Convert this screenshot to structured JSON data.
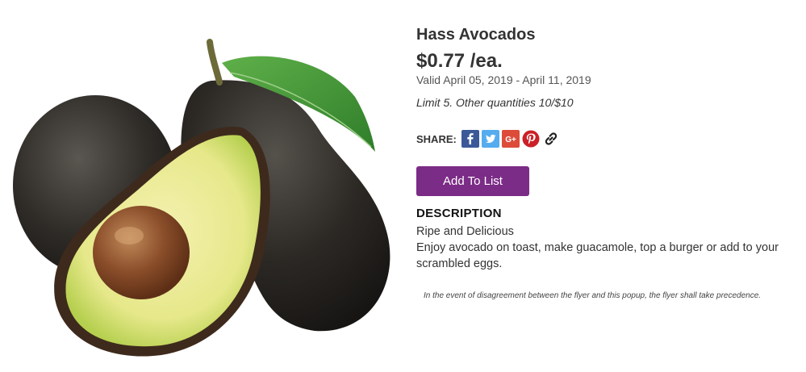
{
  "product": {
    "image_alt": "Hass avocados, one whole and one halved with pit",
    "title": "Hass Avocados",
    "price": "$0.77 /ea.",
    "valid": "Valid April 05, 2019 - April 11, 2019",
    "limit": "Limit 5. Other quantities 10/$10"
  },
  "share": {
    "label": "SHARE:",
    "buttons": [
      {
        "icon": "facebook-icon",
        "glyph": "f",
        "color": "#3b5998"
      },
      {
        "icon": "twitter-icon",
        "glyph": "t",
        "color": "#55acee"
      },
      {
        "icon": "google-plus-icon",
        "glyph": "G+",
        "color": "#dd4b39"
      },
      {
        "icon": "pinterest-icon",
        "glyph": "P",
        "color": "#cb2027"
      },
      {
        "icon": "link-icon",
        "glyph": "🔗",
        "color": "#333333"
      }
    ]
  },
  "actions": {
    "add_to_list": "Add To List",
    "button_color": "#7b2c86"
  },
  "description": {
    "heading": "DESCRIPTION",
    "line1": "Ripe and Delicious",
    "line2": "Enjoy avocado on toast, make guacamole, top a burger or add to your scrambled eggs."
  },
  "disclaimer": "In the event of disagreement between the flyer and this popup, the flyer shall take precedence."
}
